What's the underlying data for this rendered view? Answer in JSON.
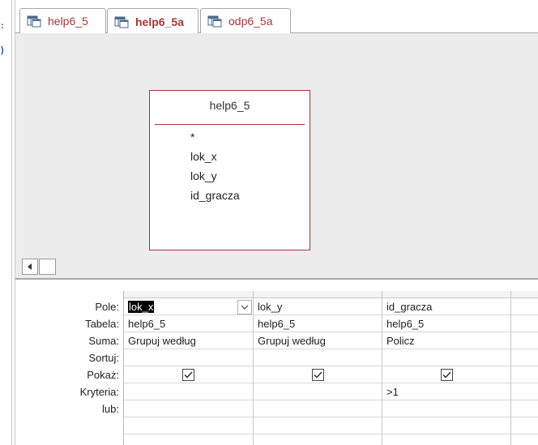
{
  "tabs": [
    {
      "label": "help6_5",
      "active": false
    },
    {
      "label": "help6_5a",
      "active": true
    },
    {
      "label": "odp6_5a",
      "active": false
    }
  ],
  "table_box": {
    "title": "help6_5",
    "fields": [
      "*",
      "lok_x",
      "lok_y",
      "id_gracza"
    ]
  },
  "grid": {
    "row_labels": [
      "Pole:",
      "Tabela:",
      "Suma:",
      "Sortuj:",
      "Pokaż:",
      "Kryteria:",
      "lub:"
    ],
    "columns": [
      {
        "pole": "lok_x",
        "tabela": "help6_5",
        "suma": "Grupuj według",
        "sortuj": "",
        "pokaz": true,
        "kryteria": "",
        "lub": ""
      },
      {
        "pole": "lok_y",
        "tabela": "help6_5",
        "suma": "Grupuj według",
        "sortuj": "",
        "pokaz": true,
        "kryteria": "",
        "lub": ""
      },
      {
        "pole": "id_gracza",
        "tabela": "help6_5",
        "suma": "Policz",
        "sortuj": "",
        "pokaz": true,
        "kryteria": ">1",
        "lub": ""
      }
    ]
  },
  "colors": {
    "accent": "#a4373a",
    "grid_line": "#c8c8c8",
    "design_bg": "#ececec"
  },
  "icons": {
    "tab_icon": "query-icon",
    "checkbox": "checkbox-checked-icon",
    "dropdown": "chevron-down-icon",
    "scroll_left": "arrow-left-icon"
  }
}
